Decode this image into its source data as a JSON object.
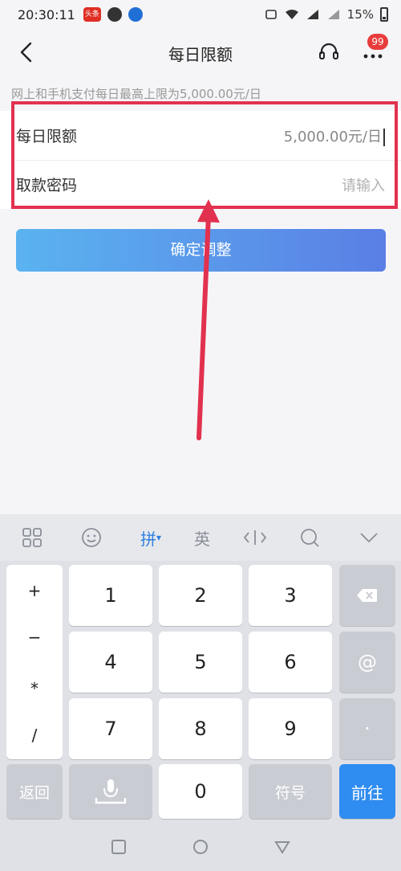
{
  "status_bar": {
    "time": "20:30:11",
    "toutiao_badge": "头条",
    "battery": "15%"
  },
  "nav": {
    "title": "每日限额",
    "badge_count": "99"
  },
  "notice": "网上和手机支付每日最高上限为5,000.00元/日",
  "form": {
    "daily_limit_label": "每日限额",
    "daily_limit_value": "5,000.00元/日",
    "password_label": "取款密码",
    "password_placeholder": "请输入"
  },
  "confirm_button": "确定调整",
  "keyboard": {
    "toolbar": {
      "pinyin": "拼",
      "english": "英"
    },
    "symbols": [
      "+",
      "−",
      "*",
      "/"
    ],
    "digits": [
      "1",
      "2",
      "3",
      "4",
      "5",
      "6",
      "7",
      "8",
      "9",
      "0"
    ],
    "dot": "·",
    "at": "@",
    "back": "返回",
    "symbol_key": "符号",
    "go": "前往"
  },
  "colors": {
    "highlight": "#e2314f",
    "accent": "#2f8cf0",
    "badge": "#e83c3c"
  }
}
